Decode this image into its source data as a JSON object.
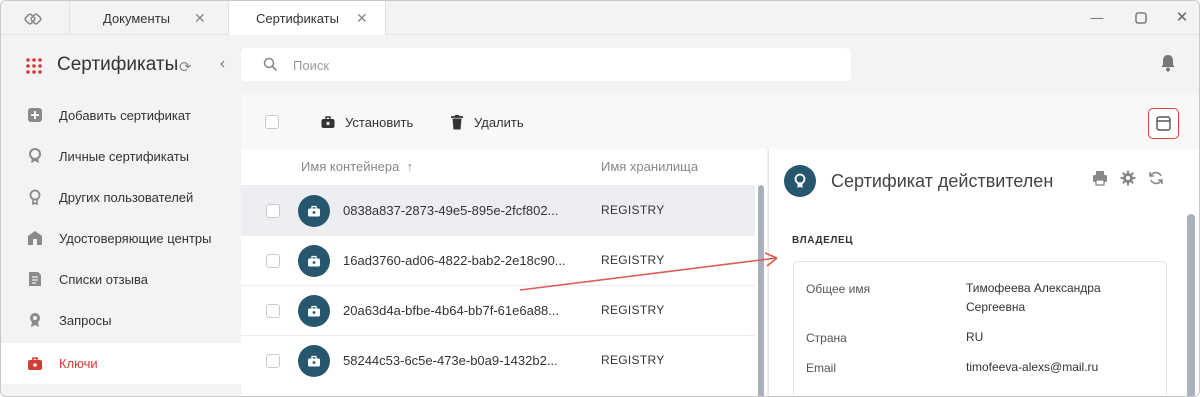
{
  "tabs": [
    {
      "label": "Документы"
    },
    {
      "label": "Сертификаты"
    }
  ],
  "sidebar": {
    "title": "Сертификаты",
    "items": [
      {
        "label": "Добавить сертификат",
        "icon": "add-certificate-icon"
      },
      {
        "label": "Личные сертификаты",
        "icon": "personal-certificate-icon"
      },
      {
        "label": "Других пользователей",
        "icon": "other-users-icon"
      },
      {
        "label": "Удостоверяющие центры",
        "icon": "certificate-authority-icon"
      },
      {
        "label": "Списки отзыва",
        "icon": "revocation-list-icon"
      },
      {
        "label": "Запросы",
        "icon": "requests-icon"
      },
      {
        "label": "Ключи",
        "icon": "key-icon",
        "active": true
      }
    ]
  },
  "search": {
    "placeholder": "Поиск",
    "value": ""
  },
  "toolbar": {
    "install_label": "Установить",
    "delete_label": "Удалить"
  },
  "table": {
    "columns": [
      "Имя контейнера",
      "Имя хранилища"
    ],
    "sort_indicator": "↑",
    "rows": [
      {
        "name": "0838a837-2873-49e5-895e-2fcf802...",
        "store": "REGISTRY",
        "selected": true
      },
      {
        "name": "16ad3760-ad06-4822-bab2-2e18c90...",
        "store": "REGISTRY"
      },
      {
        "name": "20a63d4a-bfbe-4b64-bb7f-61e6a88...",
        "store": "REGISTRY"
      },
      {
        "name": "58244c53-6c5e-473e-b0a9-1432b2...",
        "store": "REGISTRY"
      }
    ]
  },
  "detail": {
    "status": "Сертификат действителен",
    "section_title": "ВЛАДЕЛЕЦ",
    "fields": [
      {
        "label": "Общее имя",
        "value": "Тимофеева Александра Сергеевна"
      },
      {
        "label": "Страна",
        "value": "RU"
      },
      {
        "label": "Email",
        "value": "timofeeva-alexs@mail.ru"
      }
    ]
  },
  "colors": {
    "accent_red": "#d63a32",
    "teal_icon": "#26576f",
    "sidebar_bg": "#f3f3f5",
    "annotation_arrow": "#e05a55"
  }
}
